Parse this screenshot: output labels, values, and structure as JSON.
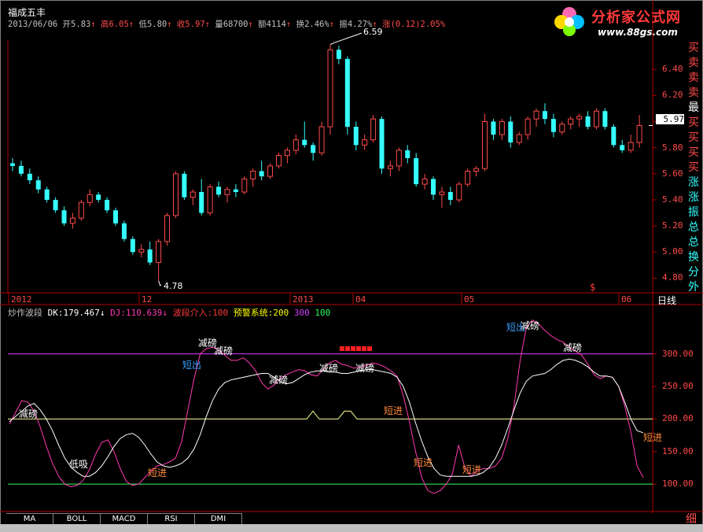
{
  "stock": {
    "name": "福成五丰",
    "date": "2013/06/06",
    "open_label": "开",
    "open": "5.83",
    "high_label": "高",
    "high": "6.05",
    "low_label": "低",
    "low": "5.80",
    "close_label": "收",
    "close": "5.97",
    "vol_label": "量",
    "vol": "68700",
    "amt_label": "额",
    "amt": "4114",
    "turn_label": "换",
    "turn": "2.46%",
    "amp_label": "振",
    "amp": "4.27%",
    "chg_label": "涨",
    "chg": "(0.12)2.05%",
    "arrow_up": "↑"
  },
  "logo": {
    "title": "分析家公式网",
    "url": "www.88gs.com"
  },
  "right_column": {
    "chars": [
      {
        "t": "买",
        "c": "#ff4a4a"
      },
      {
        "t": "卖",
        "c": "#ff4a4a"
      },
      {
        "t": "卖",
        "c": "#ff4a4a"
      },
      {
        "t": "卖",
        "c": "#ff4a4a"
      },
      {
        "t": "最",
        "c": "#ffffff"
      },
      {
        "t": "买",
        "c": "#ff4a4a"
      },
      {
        "t": "买",
        "c": "#ff4a4a"
      },
      {
        "t": "买",
        "c": "#ff4a4a"
      },
      {
        "t": "买",
        "c": "#ff4a4a"
      },
      {
        "t": "涨",
        "c": "#35ffff"
      },
      {
        "t": "涨",
        "c": "#35ffff"
      },
      {
        "t": "振",
        "c": "#35ffff"
      },
      {
        "t": "总",
        "c": "#35ffff"
      },
      {
        "t": "总",
        "c": "#35ffff"
      },
      {
        "t": "换",
        "c": "#35ffff"
      },
      {
        "t": "分",
        "c": "#35ffff"
      },
      {
        "t": "外",
        "c": "#35ffff"
      }
    ],
    "bottom_char": "细"
  },
  "main_axis": {
    "ticks": [
      "6.40",
      "6.20",
      "6.00",
      "5.80",
      "5.60",
      "5.40",
      "5.20",
      "5.00",
      "4.80"
    ],
    "current_price": "5.97",
    "max_label": "6.59",
    "min_label": "4.78",
    "dollar_mark": "$"
  },
  "x_axis": {
    "labels": [
      "2012",
      "12",
      "2013",
      "04",
      "05",
      "06"
    ],
    "period": "日线"
  },
  "indicator": {
    "name": "炒作波段",
    "dk_label": "DK:",
    "dk": "179.467",
    "dk_arrow": "↓",
    "dj_label": "DJ:",
    "dj": "110.639",
    "dj_arrow": "↓",
    "wave_label": "波段介入:",
    "wave": "100",
    "warn_label": "预警系统:",
    "warn": "200",
    "l300": "300",
    "l100": "100",
    "ticks": [
      "300.00",
      "250.00",
      "200.00",
      "150.00",
      "100.00"
    ],
    "markers": [
      "减磅",
      "低吸",
      "短进",
      "短出",
      "减磅",
      "减磅",
      "减磅",
      "减磅",
      "减磅",
      "短进",
      "短进",
      "短进",
      "短出",
      "减磅",
      "减磅",
      "短进"
    ]
  },
  "tabs": [
    "MA",
    "BOLL",
    "MACD",
    "RSI",
    "DMI"
  ],
  "colors": {
    "up": "#ff4a4a",
    "down": "#35ffff",
    "bg": "#000000",
    "axis": "#b00000"
  },
  "chart_data": {
    "type": "candlestick",
    "ylim": [
      4.7,
      6.6
    ],
    "candles": [
      [
        5.68,
        5.72,
        5.62,
        5.66
      ],
      [
        5.66,
        5.7,
        5.58,
        5.6
      ],
      [
        5.6,
        5.64,
        5.52,
        5.55
      ],
      [
        5.55,
        5.58,
        5.45,
        5.48
      ],
      [
        5.48,
        5.5,
        5.38,
        5.4
      ],
      [
        5.4,
        5.42,
        5.3,
        5.32
      ],
      [
        5.32,
        5.35,
        5.2,
        5.22
      ],
      [
        5.22,
        5.3,
        5.18,
        5.26
      ],
      [
        5.26,
        5.4,
        5.24,
        5.38
      ],
      [
        5.38,
        5.48,
        5.35,
        5.44
      ],
      [
        5.44,
        5.46,
        5.38,
        5.4
      ],
      [
        5.4,
        5.42,
        5.3,
        5.32
      ],
      [
        5.32,
        5.34,
        5.2,
        5.22
      ],
      [
        5.22,
        5.24,
        5.08,
        5.1
      ],
      [
        5.1,
        5.12,
        4.98,
        5.0
      ],
      [
        5.0,
        5.06,
        4.96,
        5.02
      ],
      [
        5.02,
        5.08,
        4.9,
        4.92
      ],
      [
        4.92,
        5.1,
        4.78,
        5.08
      ],
      [
        5.08,
        5.3,
        5.05,
        5.28
      ],
      [
        5.28,
        5.62,
        5.26,
        5.6
      ],
      [
        5.6,
        5.62,
        5.4,
        5.42
      ],
      [
        5.42,
        5.48,
        5.36,
        5.46
      ],
      [
        5.46,
        5.56,
        5.28,
        5.3
      ],
      [
        5.3,
        5.52,
        5.28,
        5.5
      ],
      [
        5.5,
        5.54,
        5.42,
        5.44
      ],
      [
        5.44,
        5.5,
        5.38,
        5.48
      ],
      [
        5.48,
        5.52,
        5.42,
        5.46
      ],
      [
        5.46,
        5.58,
        5.44,
        5.56
      ],
      [
        5.56,
        5.64,
        5.5,
        5.62
      ],
      [
        5.62,
        5.7,
        5.55,
        5.58
      ],
      [
        5.58,
        5.68,
        5.56,
        5.66
      ],
      [
        5.66,
        5.76,
        5.64,
        5.74
      ],
      [
        5.74,
        5.8,
        5.68,
        5.78
      ],
      [
        5.78,
        5.9,
        5.75,
        5.86
      ],
      [
        5.86,
        6.0,
        5.8,
        5.82
      ],
      [
        5.82,
        5.84,
        5.7,
        5.76
      ],
      [
        5.76,
        6.0,
        5.74,
        5.96
      ],
      [
        5.96,
        6.59,
        5.9,
        6.55
      ],
      [
        6.55,
        6.58,
        6.44,
        6.48
      ],
      [
        6.48,
        6.5,
        5.9,
        5.96
      ],
      [
        5.96,
        6.0,
        5.78,
        5.82
      ],
      [
        5.82,
        5.9,
        5.78,
        5.86
      ],
      [
        5.86,
        6.05,
        5.84,
        6.02
      ],
      [
        6.02,
        6.04,
        5.6,
        5.64
      ],
      [
        5.64,
        5.7,
        5.58,
        5.66
      ],
      [
        5.66,
        5.8,
        5.62,
        5.78
      ],
      [
        5.78,
        5.82,
        5.68,
        5.72
      ],
      [
        5.72,
        5.76,
        5.5,
        5.52
      ],
      [
        5.52,
        5.6,
        5.48,
        5.56
      ],
      [
        5.56,
        5.58,
        5.4,
        5.44
      ],
      [
        5.44,
        5.5,
        5.34,
        5.46
      ],
      [
        5.46,
        5.5,
        5.36,
        5.4
      ],
      [
        5.4,
        5.54,
        5.38,
        5.52
      ],
      [
        5.52,
        5.64,
        5.5,
        5.62
      ],
      [
        5.62,
        5.66,
        5.58,
        5.64
      ],
      [
        5.64,
        6.06,
        5.62,
        6.0
      ],
      [
        6.0,
        6.02,
        5.86,
        5.9
      ],
      [
        5.9,
        6.02,
        5.86,
        6.0
      ],
      [
        6.0,
        6.04,
        5.8,
        5.84
      ],
      [
        5.84,
        5.92,
        5.82,
        5.9
      ],
      [
        5.9,
        6.04,
        5.86,
        6.02
      ],
      [
        6.02,
        6.1,
        5.96,
        6.08
      ],
      [
        6.08,
        6.14,
        5.98,
        6.02
      ],
      [
        6.02,
        6.06,
        5.88,
        5.92
      ],
      [
        5.92,
        6.0,
        5.9,
        5.98
      ],
      [
        5.98,
        6.04,
        5.94,
        6.02
      ],
      [
        6.02,
        6.06,
        5.96,
        6.04
      ],
      [
        6.04,
        6.08,
        5.94,
        5.96
      ],
      [
        5.96,
        6.1,
        5.94,
        6.08
      ],
      [
        6.08,
        6.1,
        5.94,
        5.96
      ],
      [
        5.96,
        5.98,
        5.8,
        5.82
      ],
      [
        5.82,
        5.86,
        5.76,
        5.78
      ],
      [
        5.78,
        5.9,
        5.76,
        5.84
      ],
      [
        5.84,
        6.05,
        5.8,
        5.97
      ]
    ],
    "dk": [
      196,
      204,
      212,
      220,
      224,
      214,
      200,
      182,
      160,
      140,
      126,
      118,
      112,
      112,
      118,
      128,
      142,
      158,
      170,
      176,
      178,
      172,
      160,
      146,
      134,
      128,
      126,
      128,
      132,
      140,
      154,
      176,
      204,
      228,
      246,
      256,
      260,
      262,
      264,
      266,
      268,
      270,
      270,
      264,
      258,
      254,
      256,
      262,
      268,
      272,
      274,
      274,
      272,
      272,
      270,
      270,
      272,
      274,
      276,
      276,
      274,
      272,
      270,
      264,
      250,
      226,
      194,
      166,
      142,
      124,
      114,
      112,
      112,
      112,
      112,
      112,
      114,
      118,
      126,
      140,
      160,
      186,
      214,
      240,
      258,
      266,
      268,
      270,
      276,
      284,
      290,
      292,
      290,
      286,
      280,
      272,
      266,
      266,
      264,
      250,
      226,
      200,
      182,
      179
    ],
    "dj": [
      192,
      210,
      228,
      226,
      212,
      188,
      158,
      132,
      112,
      100,
      96,
      98,
      106,
      122,
      146,
      164,
      168,
      150,
      124,
      104,
      98,
      100,
      110,
      120,
      128,
      130,
      134,
      140,
      166,
      214,
      262,
      300,
      308,
      310,
      306,
      298,
      290,
      290,
      294,
      286,
      274,
      256,
      246,
      252,
      262,
      268,
      272,
      276,
      274,
      268,
      266,
      276,
      286,
      290,
      284,
      282,
      278,
      280,
      282,
      286,
      284,
      280,
      274,
      266,
      236,
      196,
      150,
      110,
      90,
      86,
      90,
      100,
      116,
      160,
      126,
      112,
      120,
      124,
      124,
      128,
      140,
      170,
      220,
      290,
      340,
      352,
      346,
      336,
      328,
      322,
      318,
      310,
      304,
      298,
      284,
      268,
      262,
      266,
      264,
      250,
      220,
      180,
      128,
      110
    ]
  }
}
